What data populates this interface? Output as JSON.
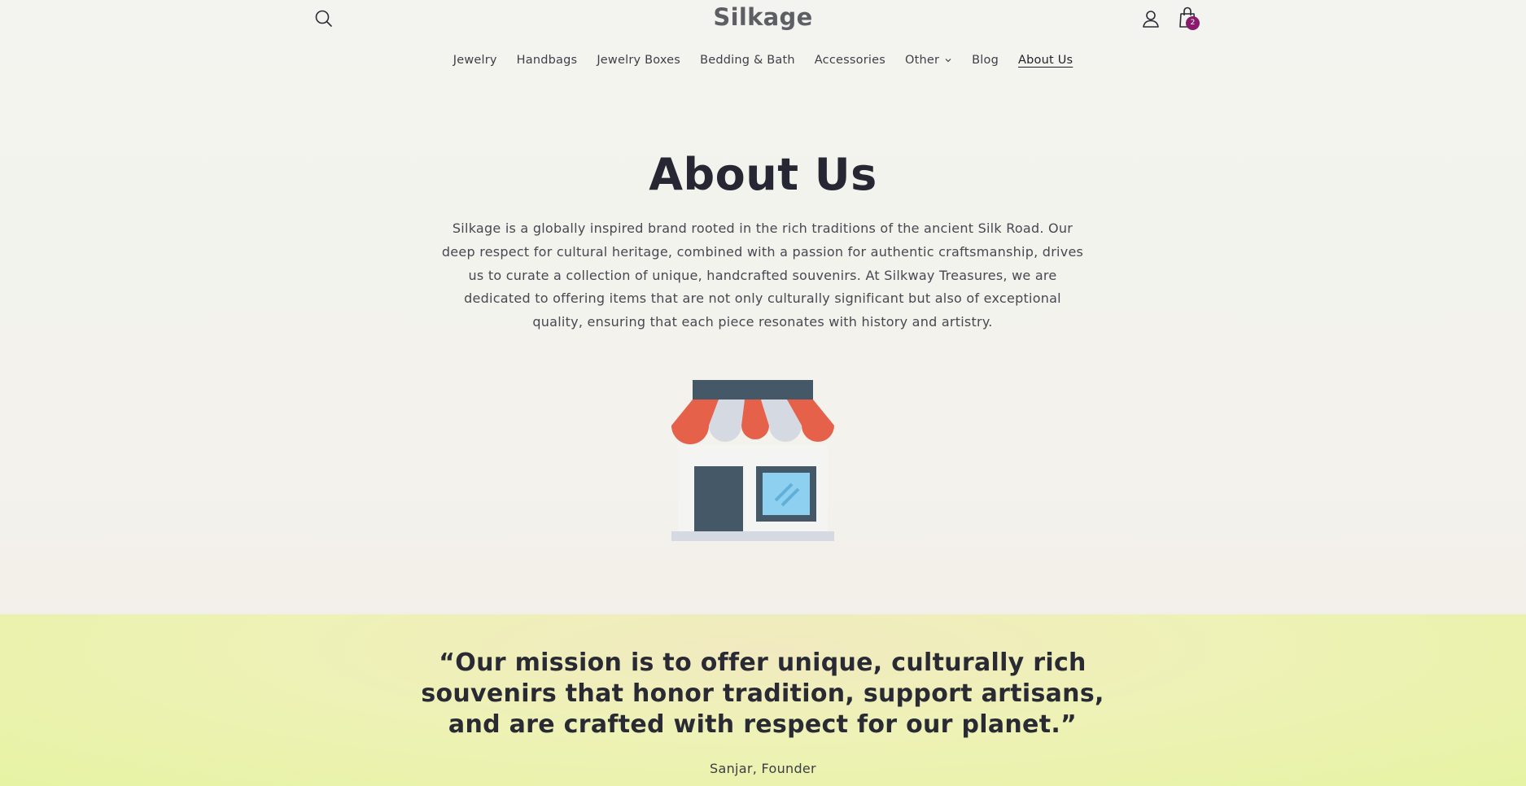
{
  "header": {
    "brand": "Silkage",
    "cart_count": "2"
  },
  "nav": {
    "items": [
      {
        "label": "Jewelry"
      },
      {
        "label": "Handbags"
      },
      {
        "label": "Jewelry Boxes"
      },
      {
        "label": "Bedding & Bath"
      },
      {
        "label": "Accessories"
      },
      {
        "label": "Other"
      },
      {
        "label": "Blog"
      },
      {
        "label": "About Us"
      }
    ],
    "active": "About Us"
  },
  "page": {
    "title": "About Us",
    "intro": "Silkage is a globally inspired brand rooted in the rich traditions of the ancient Silk Road. Our deep respect for cultural heritage, combined with a passion for authentic craftsmanship, drives us to curate a collection of unique, handcrafted souvenirs. At Silkway Treasures, we are dedicated to offering items that are not only culturally significant but also of exceptional quality, ensuring that each piece resonates with history and artistry."
  },
  "mission": {
    "quote": "“Our mission is to offer unique, culturally rich souvenirs that honor tradition, support artisans, and are crafted with respect for our planet.”",
    "author": "Sanjar, Founder"
  },
  "icons": {
    "search": "search-icon",
    "account": "account-icon",
    "cart": "cart-icon",
    "chevron": "chevron-down-icon",
    "store": "storefront-illustration"
  },
  "colors": {
    "badge": "#8a1a6b",
    "awning_red": "#e5614a",
    "awning_light": "#d5d9e2",
    "store_dark": "#455868",
    "window_blue": "#8ed0ef",
    "mission_band": "#ebf2b0"
  }
}
